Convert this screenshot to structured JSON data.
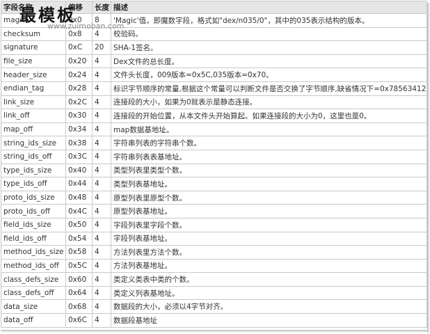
{
  "headers": [
    "字段名称",
    "偏移",
    "长度",
    "描述"
  ],
  "rows": [
    [
      "magic",
      "0x0",
      "8",
      "'Magic'值，即魔数字段，格式如\"dex/n035/0\"，其中的035表示结构的版本。"
    ],
    [
      "checksum",
      "0x8",
      "4",
      "校验码。"
    ],
    [
      "signature",
      "0xC",
      "20",
      "SHA-1签名。"
    ],
    [
      "file_size",
      "0x20",
      "4",
      "Dex文件的总长度。"
    ],
    [
      "header_size",
      "0x24",
      "4",
      "文件头长度，009版本=0x5C,035版本=0x70。"
    ],
    [
      "endian_tag",
      "0x28",
      "4",
      "标识字节顺序的常量,根据这个常量可以判断文件是否交换了字节顺序,缺省情况下=0x78563412。"
    ],
    [
      "link_size",
      "0x2C",
      "4",
      "连接段的大小，如果为0就表示是静态连接。"
    ],
    [
      "link_off",
      "0x30",
      "4",
      "连接段的开始位置，从本文件头开始算起。如果连接段的大小为0，这里也是0。"
    ],
    [
      "map_off",
      "0x34",
      "4",
      "map数据基地址。"
    ],
    [
      "string_ids_size",
      "0x38",
      "4",
      "字符串列表的字符串个数。"
    ],
    [
      "string_ids_off",
      "0x3C",
      "4",
      "字符串列表表基地址。"
    ],
    [
      "type_ids_size",
      "0x40",
      "4",
      "类型列表里类型个数。"
    ],
    [
      "type_ids_off",
      "0x44",
      "4",
      "类型列表基地址。"
    ],
    [
      "proto_ids_size",
      "0x48",
      "4",
      "原型列表里原型个数。"
    ],
    [
      "proto_ids_off",
      "0x4C",
      "4",
      "原型列表基地址。"
    ],
    [
      "field_ids_size",
      "0x50",
      "4",
      "字段列表里字段个数。"
    ],
    [
      "field_ids_off",
      "0x54",
      "4",
      "字段列表基地址。"
    ],
    [
      "method_ids_size",
      "0x58",
      "4",
      "方法列表里方法个数。"
    ],
    [
      "method_ids_off",
      "0x5C",
      "4",
      "方法列表基地址。"
    ],
    [
      "class_defs_size",
      "0x60",
      "4",
      "类定义类表中类的个数。"
    ],
    [
      "class_defs_off",
      "0x64",
      "4",
      "类定义列表基地址。"
    ],
    [
      "data_size",
      "0x68",
      "4",
      "数据段的大小，必须以4字节对齐。"
    ],
    [
      "data_off",
      "0x6C",
      "4",
      "数据段基地址"
    ]
  ],
  "watermark": {
    "title": "最模板",
    "url": "www.zuimoban.com"
  }
}
